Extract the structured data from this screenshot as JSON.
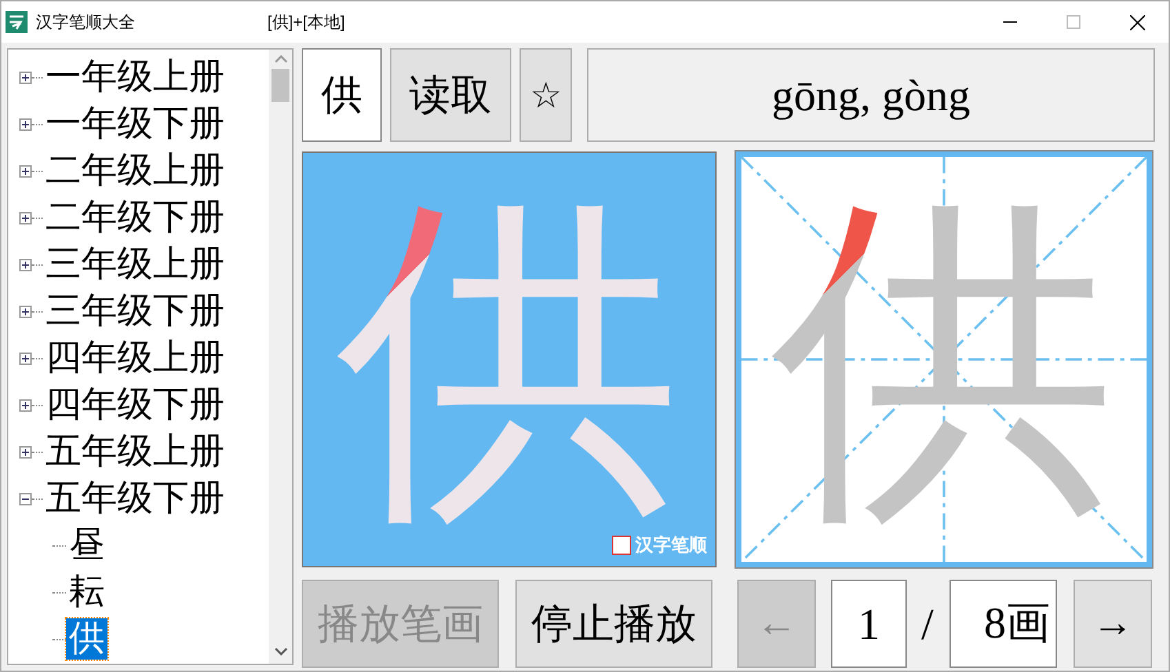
{
  "window": {
    "title": "汉字笔顺大全",
    "subtitle": "[供]+[本地]"
  },
  "tree": [
    {
      "label": "一年级上册",
      "expanded": false
    },
    {
      "label": "一年级下册",
      "expanded": false
    },
    {
      "label": "二年级上册",
      "expanded": false
    },
    {
      "label": "二年级下册",
      "expanded": false
    },
    {
      "label": "三年级上册",
      "expanded": false
    },
    {
      "label": "三年级下册",
      "expanded": false
    },
    {
      "label": "四年级上册",
      "expanded": false
    },
    {
      "label": "四年级下册",
      "expanded": false
    },
    {
      "label": "五年级上册",
      "expanded": false
    },
    {
      "label": "五年级下册",
      "expanded": true,
      "children": [
        {
          "label": "昼",
          "selected": false
        },
        {
          "label": "耘",
          "selected": false
        },
        {
          "label": "供",
          "selected": true
        }
      ]
    }
  ],
  "toolbar": {
    "character": "供",
    "read_button": "读取",
    "favorite_button": "☆",
    "pinyin": "gōng, gòng"
  },
  "animation_panel": {
    "character": "供",
    "logo_text": "汉字笔顺"
  },
  "grid_panel": {
    "character": "供"
  },
  "controls": {
    "play_button": {
      "label": "播放笔画",
      "disabled": true
    },
    "stop_button": {
      "label": "停止播放",
      "disabled": false
    },
    "prev_button": {
      "label": "←",
      "disabled": true
    },
    "current_stroke": "1",
    "separator": "/",
    "total_strokes": "8画",
    "next_button": {
      "label": "→",
      "disabled": false
    }
  }
}
